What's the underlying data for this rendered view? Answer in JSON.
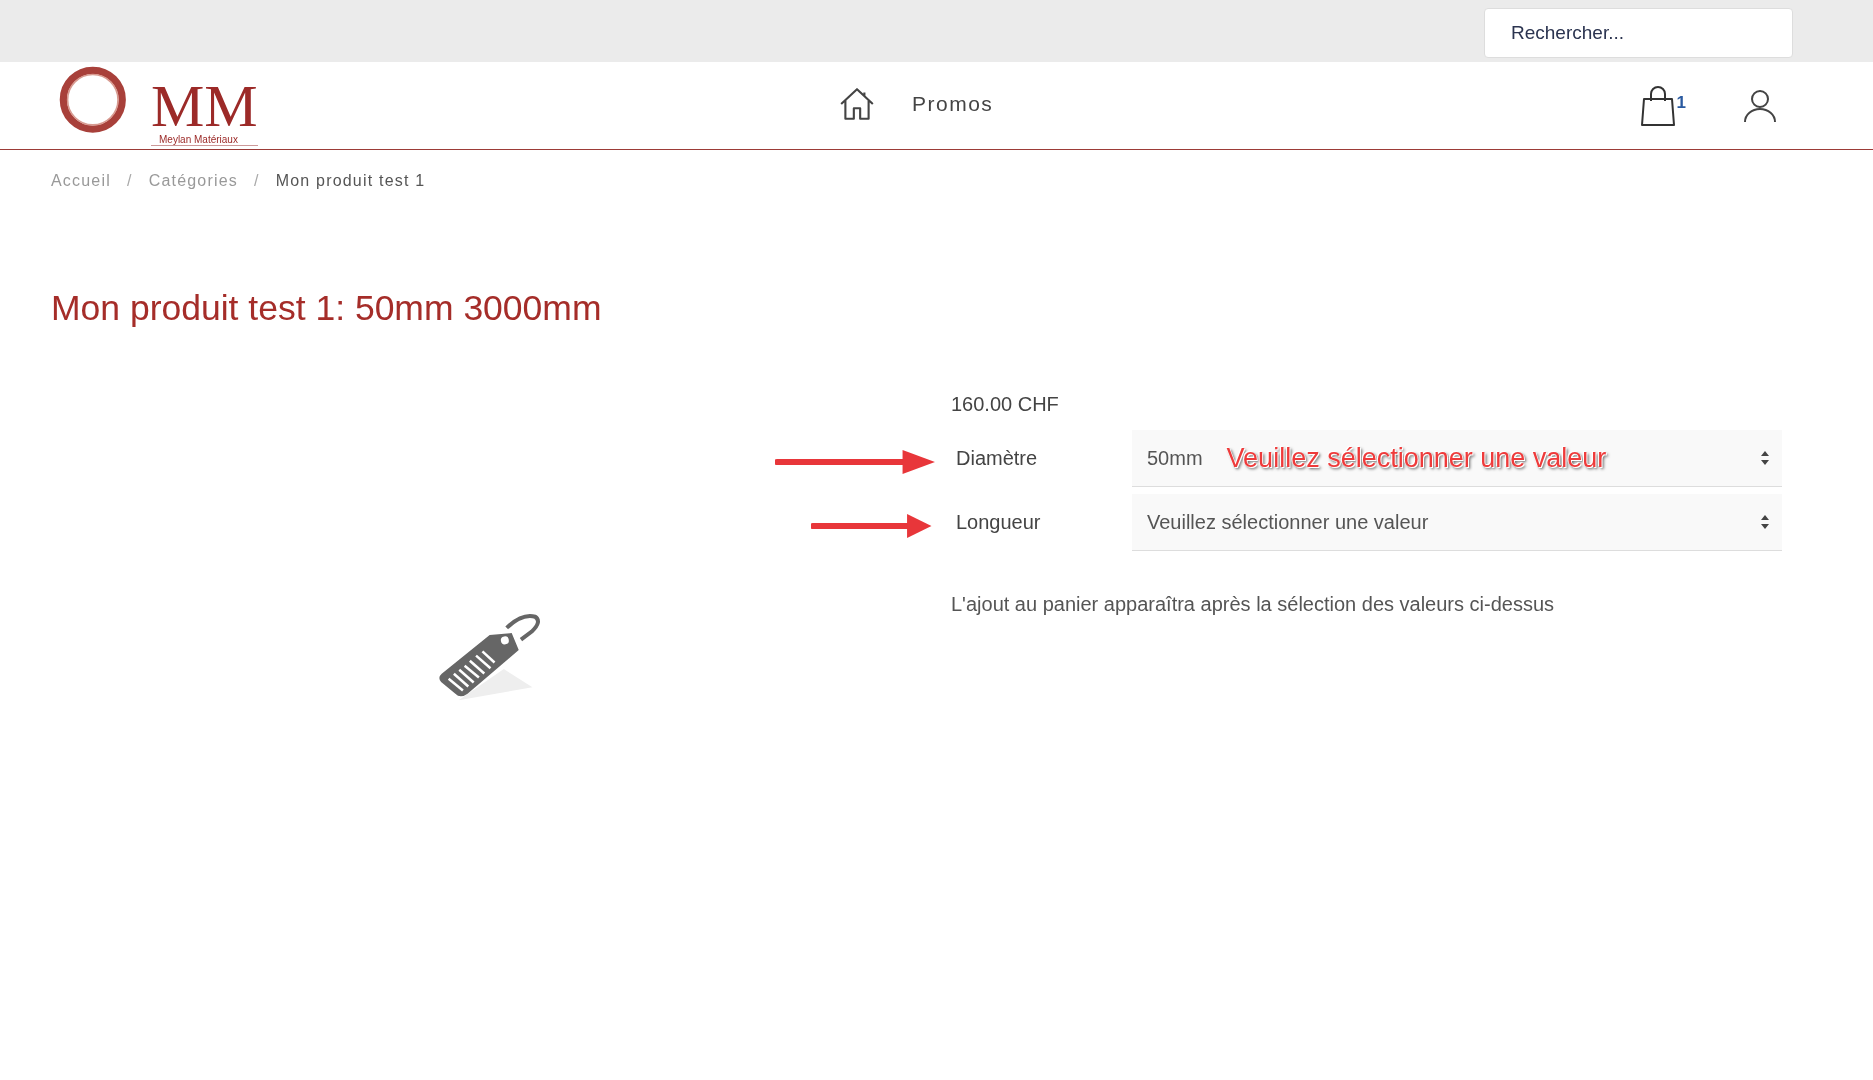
{
  "search": {
    "placeholder": "Rechercher..."
  },
  "logo": {
    "mark": "MM",
    "subtitle": "Meylan Matériaux"
  },
  "nav": [
    {
      "label": "Promos"
    }
  ],
  "cart": {
    "count": "1"
  },
  "breadcrumb": [
    {
      "label": "Accueil",
      "current": false
    },
    {
      "label": "Catégories",
      "current": false,
      "separator": "/"
    },
    {
      "label": "Mon produit test 1",
      "current": true,
      "separator": "/"
    }
  ],
  "product": {
    "title": "Mon produit test 1: 50mm 3000mm",
    "price": "160.00 CHF",
    "options": [
      {
        "label": "Diamètre",
        "value": "50mm",
        "arrow": true,
        "overlay_note": "Veuillez sélectionner une valeur"
      },
      {
        "label": "Longueur",
        "value": "Veuillez sélectionner une valeur",
        "arrow": true
      }
    ],
    "note": "L'ajout au panier apparaîtra après la sélection des valeurs ci-dessus"
  }
}
